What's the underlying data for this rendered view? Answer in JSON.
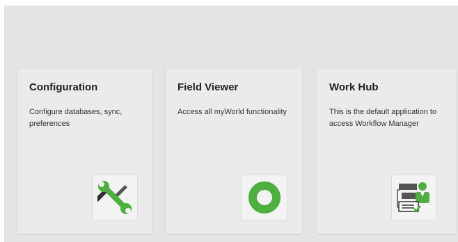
{
  "cards": [
    {
      "title": "Configuration",
      "description": "Configure databases, sync, preferences",
      "icon": "wrench-screwdriver-icon",
      "icon_color": "#4caf3e"
    },
    {
      "title": "Field Viewer",
      "description": "Access all myWorld functionality",
      "icon": "ring-icon",
      "icon_color": "#4caf3e"
    },
    {
      "title": "Work Hub",
      "description": "This is the default application to access Workflow Manager",
      "icon": "workflow-user-icon",
      "icon_color": "#4caf3e"
    }
  ],
  "colors": {
    "background": "#e4e4e4",
    "card": "#ebebeb",
    "accent": "#4caf3e",
    "text": "#222222"
  }
}
